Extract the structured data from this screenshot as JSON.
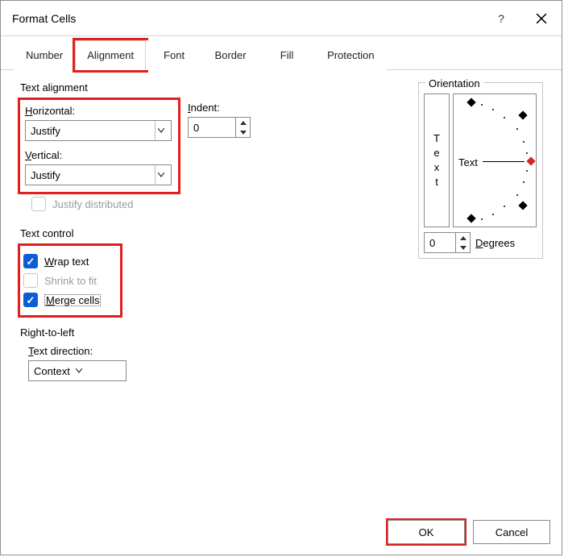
{
  "titlebar": {
    "title": "Format Cells"
  },
  "tabs": {
    "number": "Number",
    "alignment": "Alignment",
    "font": "Font",
    "border": "Border",
    "fill": "Fill",
    "protection": "Protection"
  },
  "textAlignment": {
    "section": "Text alignment",
    "horizontalLabelPrefix": "H",
    "horizontalLabelRest": "orizontal:",
    "horizontalValue": "Justify",
    "verticalLabelPrefix": "V",
    "verticalLabelRest": "ertical:",
    "verticalValue": "Justify",
    "indentLabelPrefix": "I",
    "indentLabelRest": "ndent:",
    "indentValue": "0",
    "justifyDistributed": "Justify distributed"
  },
  "textControl": {
    "section": "Text control",
    "wrapPrefix": "W",
    "wrapRest": "rap text",
    "shrinkPrefix": "S",
    "shrinkRest": "hrink to fit",
    "mergePrefix": "M",
    "mergeRest": "erge cells"
  },
  "rtl": {
    "section": "Right-to-left",
    "labelPrefix": "T",
    "labelRest": "ext direction:",
    "value": "Context"
  },
  "orientation": {
    "section": "Orientation",
    "vertT": "T",
    "vertE": "e",
    "vertX": "x",
    "vertT2": "t",
    "dialLabel": "Text",
    "degreesValue": "0",
    "degreesLabelPrefix": "D",
    "degreesLabelRest": "egrees"
  },
  "footer": {
    "ok": "OK",
    "cancel": "Cancel"
  }
}
